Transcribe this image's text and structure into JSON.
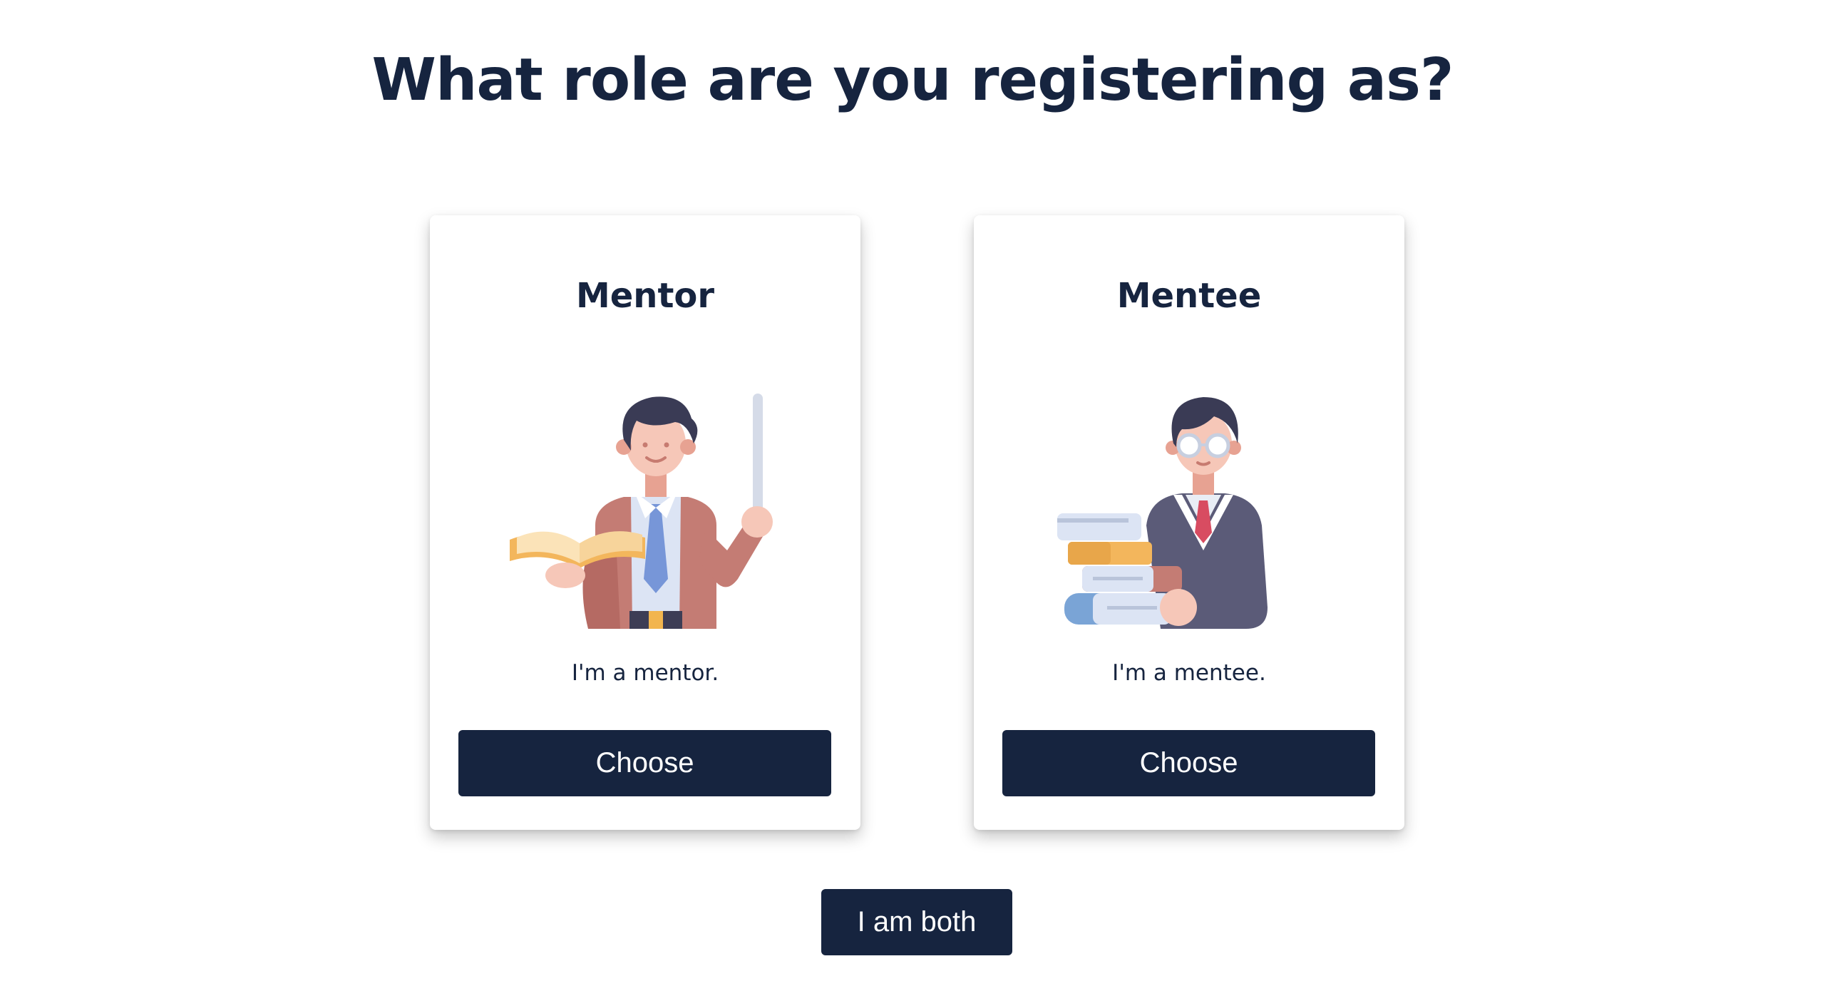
{
  "page": {
    "title": "What role are you registering as?"
  },
  "cards": [
    {
      "title": "Mentor",
      "description": "I'm a mentor.",
      "button_label": "Choose",
      "illustration": "teacher-icon"
    },
    {
      "title": "Mentee",
      "description": "I'm a mentee.",
      "button_label": "Choose",
      "illustration": "student-icon"
    }
  ],
  "both_button_label": "I am both",
  "colors": {
    "primary": "#16243f",
    "background": "#ffffff",
    "button_text": "#ffffff"
  }
}
